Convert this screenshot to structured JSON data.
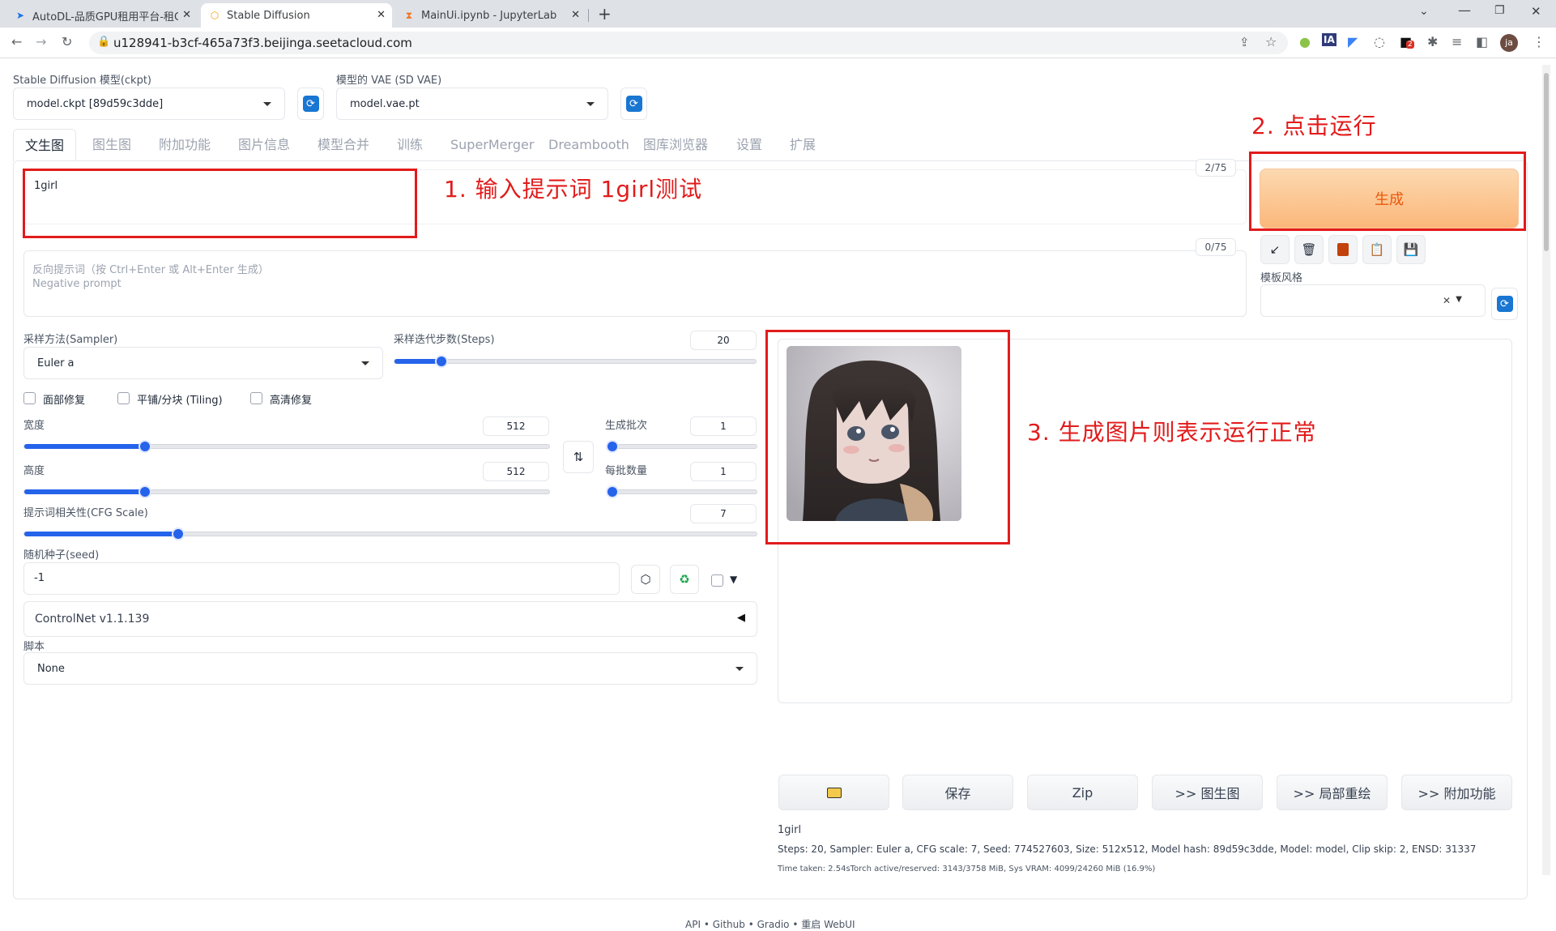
{
  "browser": {
    "tabs": [
      {
        "title": "AutoDL-品质GPU租用平台-租G",
        "icon": "autodl-icon"
      },
      {
        "title": "Stable Diffusion",
        "icon": "sd-icon"
      },
      {
        "title": "MainUi.ipynb - JupyterLab",
        "icon": "jupyter-icon"
      }
    ],
    "url": "u128941-b3cf-465a73f3.beijinga.seetacloud.com",
    "profile": "ja",
    "ext_badge": "2"
  },
  "models": {
    "ckpt_label": "Stable Diffusion 模型(ckpt)",
    "ckpt_value": "model.ckpt [89d59c3dde]",
    "vae_label": "模型的 VAE (SD VAE)",
    "vae_value": "model.vae.pt"
  },
  "tabs": [
    "文生图",
    "图生图",
    "附加功能",
    "图片信息",
    "模型合并",
    "训练",
    "SuperMerger",
    "Dreambooth",
    "图库浏览器",
    "设置",
    "扩展"
  ],
  "prompt": {
    "value": "1girl",
    "counter": "2/75",
    "neg_placeholder_1": "反向提示词（按 Ctrl+Enter 或 Alt+Enter 生成）",
    "neg_placeholder_2": "Negative prompt",
    "neg_counter": "0/75"
  },
  "generate_label": "生成",
  "style_label": "模板风格",
  "sampler": {
    "label": "采样方法(Sampler)",
    "value": "Euler a"
  },
  "steps": {
    "label": "采样迭代步数(Steps)",
    "value": "20",
    "fraction": 0.13
  },
  "checkboxes": [
    "面部修复",
    "平铺/分块 (Tiling)",
    "高清修复"
  ],
  "width": {
    "label": "宽度",
    "value": "512",
    "fraction": 0.23
  },
  "height": {
    "label": "高度",
    "value": "512",
    "fraction": 0.23
  },
  "batch_count": {
    "label": "生成批次",
    "value": "1",
    "fraction": 0.0
  },
  "batch_size": {
    "label": "每批数量",
    "value": "1",
    "fraction": 0.0
  },
  "cfg": {
    "label": "提示词相关性(CFG Scale)",
    "value": "7",
    "fraction": 0.21
  },
  "seed": {
    "label": "随机种子(seed)",
    "value": "-1"
  },
  "controlnet_label": "ControlNet v1.1.139",
  "script": {
    "label": "脚本",
    "value": "None"
  },
  "output_buttons": [
    "保存",
    "Zip",
    ">> 图生图",
    ">> 局部重绘",
    ">> 附加功能"
  ],
  "info": {
    "prompt": "1girl",
    "params": "Steps: 20, Sampler: Euler a, CFG scale: 7, Seed: 774527603, Size: 512x512, Model hash: 89d59c3dde, Model: model, Clip skip: 2, ENSD: 31337",
    "time": "Time taken: 2.54sTorch active/reserved: 3143/3758 MiB, Sys VRAM: 4099/24260 MiB (16.9%)"
  },
  "footer": [
    "API",
    "Github",
    "Gradio",
    "重启 WebUI"
  ],
  "footer_sep": "•",
  "annotations": {
    "a1": "1. 输入提示词 1girl测试",
    "a2": "2. 点击运行",
    "a3": "3. 生成图片则表示运行正常"
  },
  "colors": {
    "annotation_red": "#e21b1b",
    "accent_blue": "#2563eb",
    "generate_orange": "#f97316"
  }
}
